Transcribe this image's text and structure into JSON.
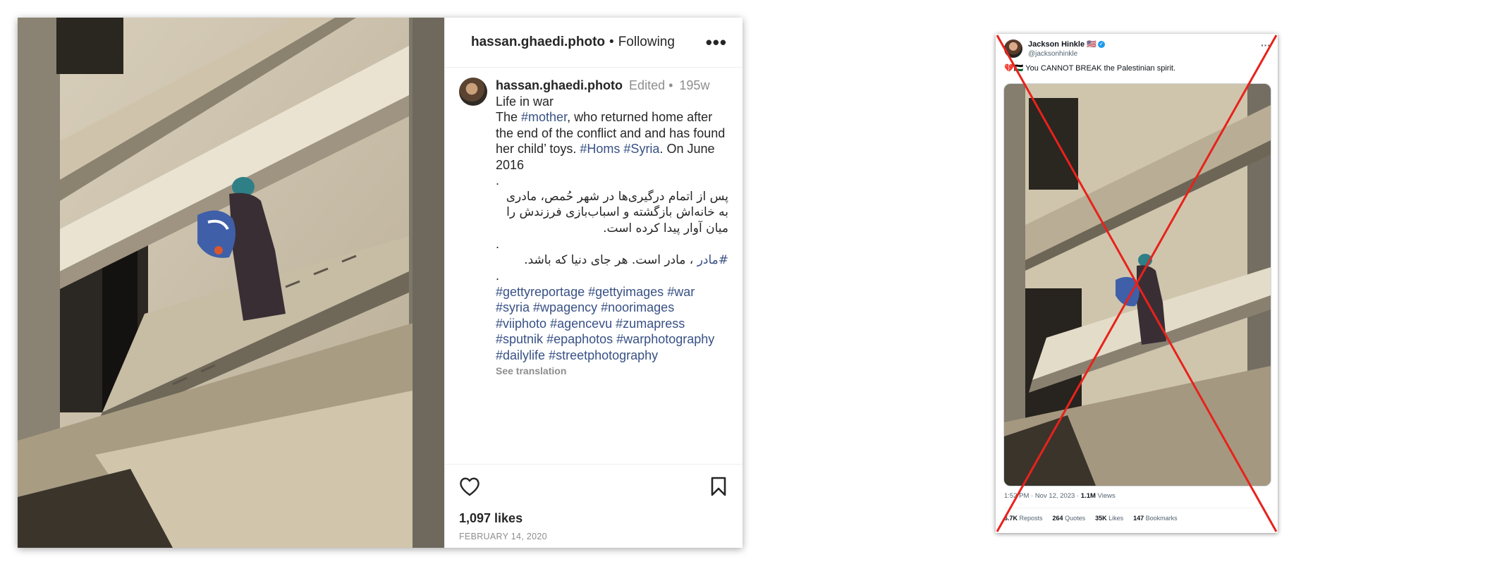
{
  "instagram": {
    "header": {
      "username": "hassan.ghaedi.photo",
      "separator": "•",
      "follow_status": "Following",
      "more_icon": "more-horizontal-icon"
    },
    "caption": {
      "username": "hassan.ghaedi.photo",
      "edited": "Edited •",
      "age": "195w",
      "title": "Life in war",
      "line1_prefix": "The ",
      "line1_hashtag": "#mother",
      "line1_suffix": ", who returned home after the end of the conflict and and has found her child’ toys. ",
      "hashtag_homs": "#Homs",
      "hashtag_syria": "#Syria",
      "line1_end": ". On June 2016",
      "dot1": ".",
      "persian1": "پس از اتمام درگیری‌ها در شهر حُمص، مادری به خانه‌اش بازگشته و اسباب‌بازی فرزندش را میان آوار پیدا کرده است.",
      "dot2": ".",
      "persian2_link": "#مادر",
      "persian2_text": "، مادر است. هر جای دنیا که باشد.",
      "dot3": ".",
      "hashtags": [
        "#gettyreportage",
        "#gettyimages",
        "#war",
        "#syria",
        "#wpagency",
        "#noorimages",
        "#viiphoto",
        "#agencevu",
        "#zumapress",
        "#sputnik",
        "#epaphotos",
        "#warphotography",
        "#dailylife",
        "#streetphotography"
      ],
      "see_translation": "See translation"
    },
    "actions": {
      "like_icon": "heart-icon",
      "save_icon": "bookmark-icon",
      "likes": "1,097 likes",
      "date": "FEBRUARY 14, 2020"
    }
  },
  "tweet": {
    "name": "Jackson Hinkle 🇺🇸",
    "verified_icon": "verified-badge-icon",
    "handle": "@jacksonhinkle",
    "text": "💔🇵🇸 You CANNOT BREAK the Palestinian spirit.",
    "timestamp": "1:52 PM · Nov 12, 2023 · ",
    "views_count": "1.1M",
    "views_label": " Views",
    "stats": {
      "reposts_count": "6.7K",
      "reposts_label": " Reposts",
      "quotes_count": "264",
      "quotes_label": " Quotes",
      "likes_count": "35K",
      "likes_label": " Likes",
      "bookmarks_count": "147",
      "bookmarks_label": " Bookmarks"
    },
    "cross_color": "#e8221b"
  },
  "colors": {
    "hashtag": "#385185",
    "muted": "#8e8e8e",
    "twitter_blue": "#1d9bf0"
  }
}
